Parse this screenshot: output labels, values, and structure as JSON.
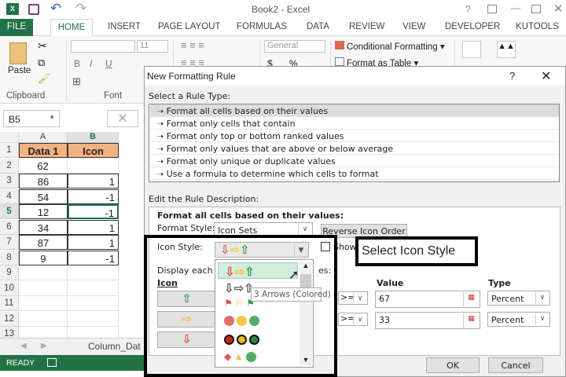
{
  "window": {
    "title": "Book2 - Excel",
    "help": "?"
  },
  "tabs": [
    "FILE",
    "HOME",
    "INSERT",
    "PAGE LAYOUT",
    "FORMULAS",
    "DATA",
    "REVIEW",
    "VIEW",
    "DEVELOPER",
    "KUTOOLS"
  ],
  "ribbon": {
    "paste": "Paste",
    "clipboard": "Clipboard",
    "font": "Font",
    "font_size": "11",
    "number_format": "General",
    "conditional_formatting": "Conditional Formatting",
    "format_as_table": "Format as Table",
    "bold": "B",
    "italic": "I",
    "underline": "U",
    "currency": "$",
    "percent": "%",
    "comma": ","
  },
  "name_box": "B5",
  "sheet": {
    "columns": [
      "A",
      "B"
    ],
    "rows": [
      "1",
      "2",
      "3",
      "4",
      "5",
      "6",
      "7",
      "8",
      "9",
      "10",
      "11",
      "12",
      "13"
    ],
    "header": [
      "Data 1",
      "Icon"
    ],
    "data": [
      [
        "62",
        ""
      ],
      [
        "86",
        "1"
      ],
      [
        "54",
        "-1"
      ],
      [
        "12",
        "-1"
      ],
      [
        "34",
        "1"
      ],
      [
        "87",
        "1"
      ],
      [
        "9",
        "-1"
      ]
    ],
    "tab": "Column_Dat"
  },
  "status": "READY",
  "dialog": {
    "title": "New Formatting Rule",
    "help": "?",
    "select_rule_label": "Select a Rule Type:",
    "rule_types": [
      "Format all cells based on their values",
      "Format only cells that contain",
      "Format only top or bottom ranked values",
      "Format only values that are above or below average",
      "Format only unique or duplicate values",
      "Use a formula to determine which cells to format"
    ],
    "edit_label": "Edit the Rule Description:",
    "format_all_label": "Format all cells based on their values:",
    "format_style_label": "Format Style:",
    "format_style": "Icon Sets",
    "reverse_button": "Reverse Icon Order",
    "icon_style_label": "Icon Style:",
    "show_label": "Show I",
    "display_label": "Display each ic",
    "display_label_end": "es:",
    "icon_col": "Icon",
    "value_col": "Value",
    "type_col": "Type",
    "rows": [
      {
        "op": ">=",
        "value": "67",
        "type": "Percent"
      },
      {
        "op": ">=",
        "value": "33",
        "type": "Percent"
      }
    ],
    "ok": "OK",
    "cancel": "Cancel",
    "tooltip": "3 Arrows (Colored)"
  },
  "annotation": "Select Icon Style",
  "colors": {
    "excel_green": "#217346",
    "header_fill": "#f4b183"
  }
}
